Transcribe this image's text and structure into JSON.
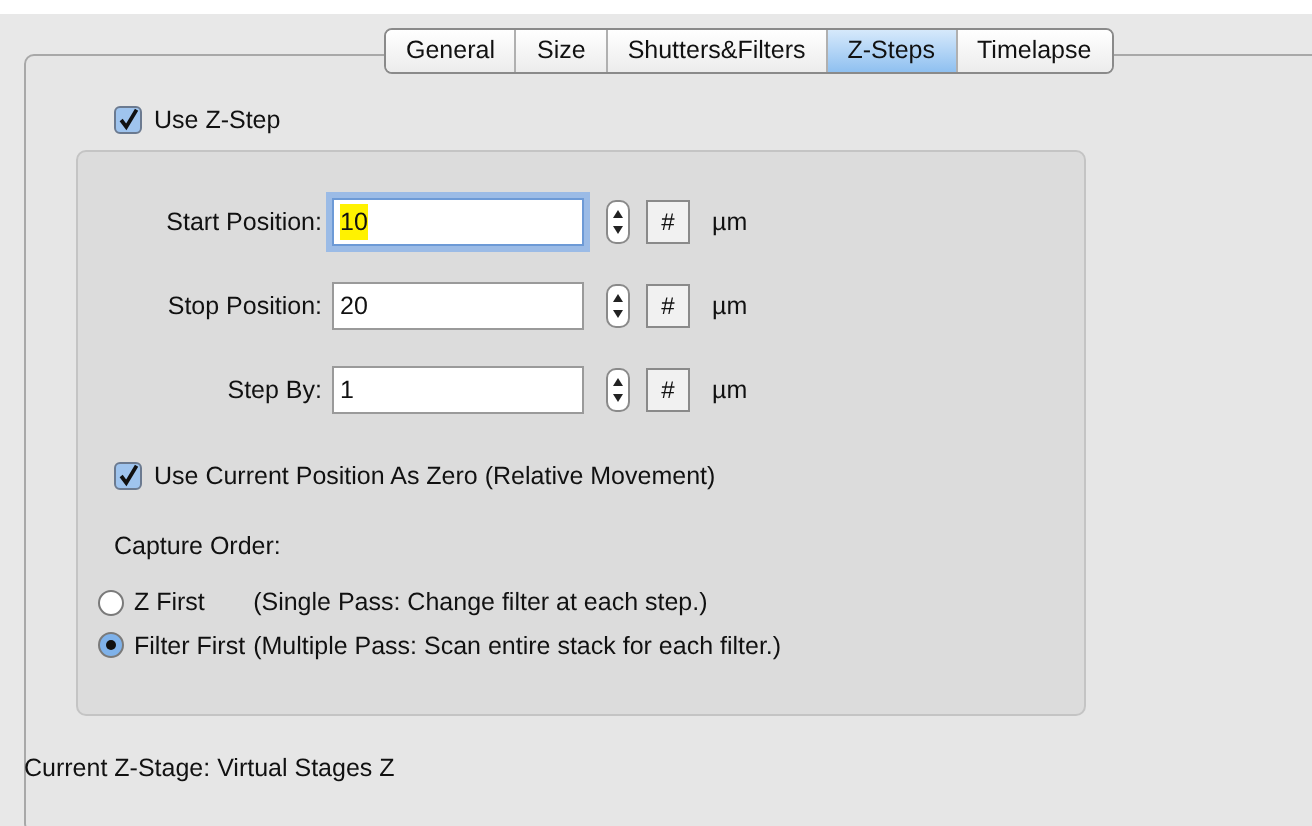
{
  "tabs": [
    {
      "label": "General",
      "selected": false
    },
    {
      "label": "Size",
      "selected": false
    },
    {
      "label": "Shutters&Filters",
      "selected": false
    },
    {
      "label": "Z-Steps",
      "selected": true
    },
    {
      "label": "Timelapse",
      "selected": false
    }
  ],
  "use_z_step": {
    "label": "Use Z-Step",
    "checked": true
  },
  "fields": [
    {
      "label": "Start Position:",
      "value": "10",
      "focused": true,
      "button": "#",
      "unit": "µm"
    },
    {
      "label": "Stop Position:",
      "value": "20",
      "focused": false,
      "button": "#",
      "unit": "µm"
    },
    {
      "label": "Step By:",
      "value": "1",
      "focused": false,
      "button": "#",
      "unit": "µm"
    }
  ],
  "use_current_position": {
    "label": "Use Current Position As Zero (Relative Movement)",
    "checked": true
  },
  "capture_order": {
    "label": "Capture Order:",
    "options": [
      {
        "label": "Z First",
        "description": "(Single Pass: Change filter at each step.)",
        "selected": false
      },
      {
        "label": "Filter First",
        "description": "(Multiple Pass: Scan entire stack for each filter.)",
        "selected": true
      }
    ]
  },
  "current_stage": "Current Z-Stage: Virtual Stages Z"
}
